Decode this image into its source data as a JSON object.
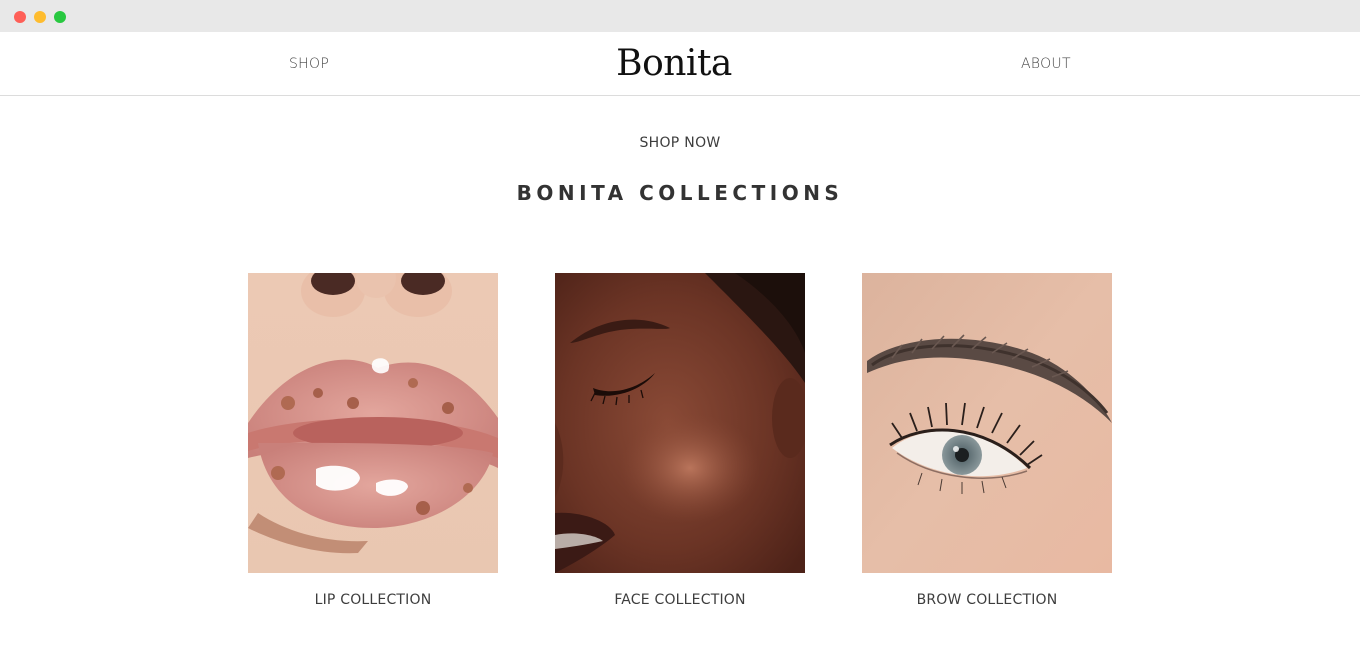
{
  "window": {
    "controls": [
      "close",
      "minimize",
      "maximize"
    ]
  },
  "nav": {
    "shop_label": "SHOP",
    "logo_text": "Bonita",
    "about_label": "ABOUT"
  },
  "hero": {
    "shop_now_label": "SHOP NOW",
    "section_title": "BONITA COLLECTIONS"
  },
  "collections": [
    {
      "label": "LIP COLLECTION",
      "image": "glossy-lips-photo"
    },
    {
      "label": "FACE COLLECTION",
      "image": "glowing-skin-face-photo"
    },
    {
      "label": "BROW COLLECTION",
      "image": "brow-and-eye-photo"
    }
  ],
  "colors": {
    "text": "#3d3d3d",
    "logo": "#111111",
    "divider": "#dcdcdc",
    "background": "#ffffff"
  }
}
